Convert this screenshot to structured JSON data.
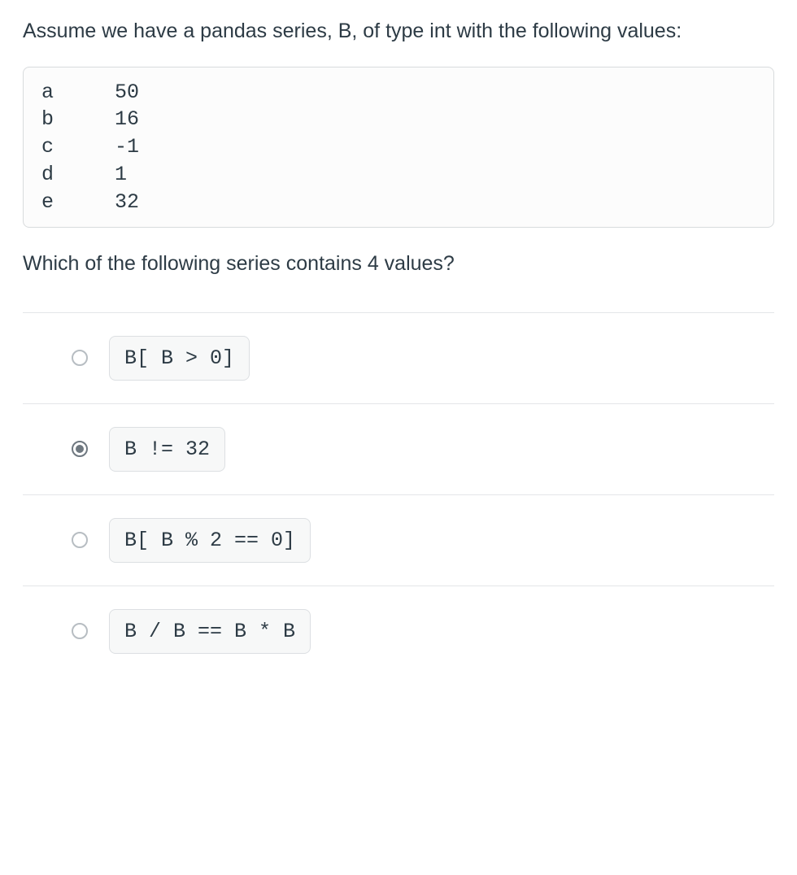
{
  "question": {
    "intro": "Assume we have a pandas series, B, of type int with the following values:",
    "series_text": "a     50\nb     16\nc     -1\nd     1\ne     32",
    "prompt": "Which of the following series contains 4 values?"
  },
  "answers": [
    {
      "code": "B[ B > 0]",
      "selected": false
    },
    {
      "code": "B != 32",
      "selected": true
    },
    {
      "code": "B[ B % 2 == 0]",
      "selected": false
    },
    {
      "code": "B / B == B * B",
      "selected": false
    }
  ]
}
